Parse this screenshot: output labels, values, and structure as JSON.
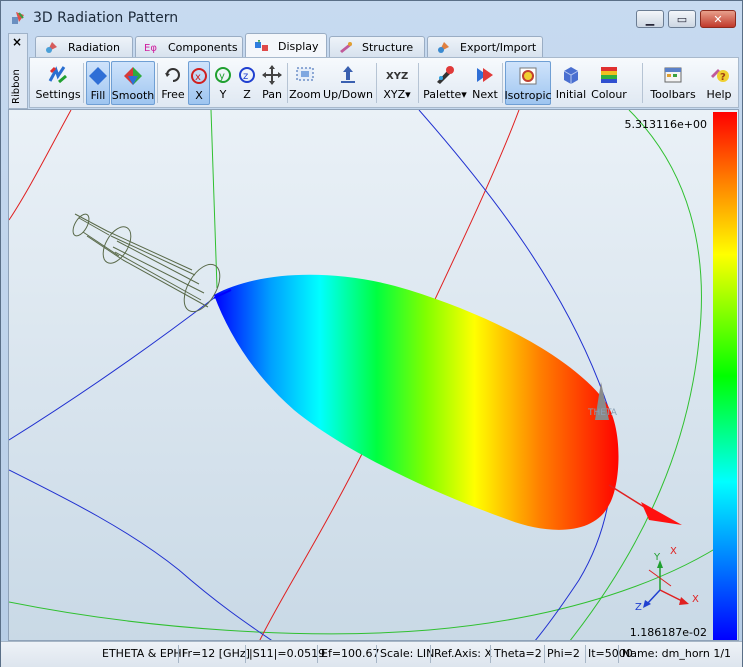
{
  "window": {
    "title": "3D Radiation Pattern"
  },
  "ribbon": {
    "label": "Ribbon",
    "close": "×"
  },
  "tabs": [
    {
      "label": "Radiation"
    },
    {
      "label": "Components"
    },
    {
      "label": "Display"
    },
    {
      "label": "Structure"
    },
    {
      "label": "Export/Import"
    }
  ],
  "toolbar": {
    "settings": "Settings",
    "fill": "Fill",
    "smooth": "Smooth",
    "free": "Free",
    "x": "X",
    "y": "Y",
    "z": "Z",
    "pan": "Pan",
    "zoom": "Zoom",
    "updown": "Up/Down",
    "xyz": "XYZ",
    "palette": "Palette",
    "next": "Next",
    "isotropic": "Isotropic",
    "initial": "Initial",
    "colour": "Colour",
    "toolbars": "Toolbars",
    "help": "Help",
    "xyz_icon_text": "XYZ"
  },
  "viewport": {
    "max_value": "5.313116e+00",
    "min_value": "1.186187e-02",
    "theta_marker": "THETA",
    "triad": {
      "x": "X",
      "y": "Y",
      "z": "Z"
    },
    "axis_marker_x": "X"
  },
  "status": {
    "mode": "ETHETA & EPHI",
    "freq": "Fr=12 [GHz]",
    "s11": "|S11|=0.0519",
    "ef": "Ef=100.67",
    "scale": "Scale: LIN",
    "refaxis": "Ref.Axis: X",
    "theta": "Theta=2",
    "phi": "Phi=2",
    "it": "It=5000",
    "name": "Name: dm_horn 1/1"
  },
  "colors": {
    "accent": "#3a7bd5",
    "titlebar": "#c7daf0",
    "colorbar_top": "#ff0000",
    "colorbar_bottom": "#0000ff"
  }
}
